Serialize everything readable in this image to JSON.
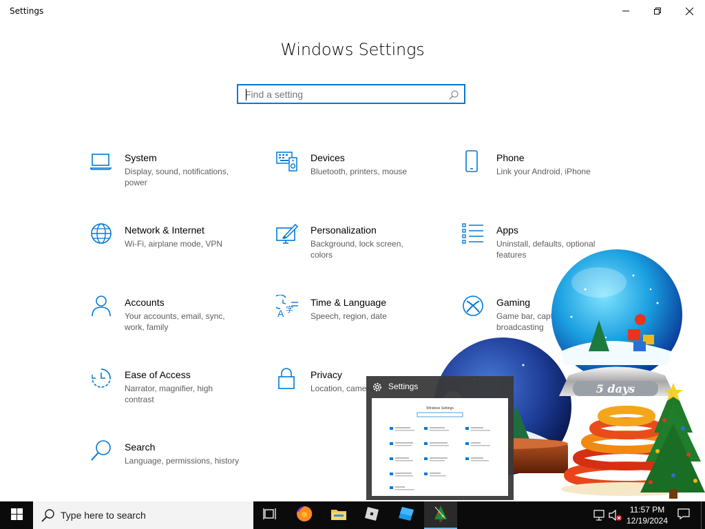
{
  "window": {
    "title": "Settings",
    "heading": "Windows Settings"
  },
  "search": {
    "placeholder": "Find a setting"
  },
  "tiles": [
    {
      "name": "System",
      "desc": "Display, sound, notifications, power",
      "icon": "laptop-icon"
    },
    {
      "name": "Devices",
      "desc": "Bluetooth, printers, mouse",
      "icon": "keyboard-speaker-icon"
    },
    {
      "name": "Phone",
      "desc": "Link your Android, iPhone",
      "icon": "phone-icon"
    },
    {
      "name": "Network & Internet",
      "desc": "Wi-Fi, airplane mode, VPN",
      "icon": "globe-icon"
    },
    {
      "name": "Personalization",
      "desc": "Background, lock screen, colors",
      "icon": "paint-monitor-icon"
    },
    {
      "name": "Apps",
      "desc": "Uninstall, defaults, optional features",
      "icon": "apps-list-icon"
    },
    {
      "name": "Accounts",
      "desc": "Your accounts, email, sync, work, family",
      "icon": "person-icon"
    },
    {
      "name": "Time & Language",
      "desc": "Speech, region, date",
      "icon": "time-language-icon"
    },
    {
      "name": "Gaming",
      "desc": "Game bar, captures, broadcasting",
      "icon": "xbox-icon"
    },
    {
      "name": "Ease of Access",
      "desc": "Narrator, magnifier, high contrast",
      "icon": "ease-of-access-icon"
    },
    {
      "name": "Privacy",
      "desc": "Location, camera",
      "icon": "lock-icon"
    },
    {
      "name": "Search",
      "desc": "Language, permissions, history",
      "icon": "magnifier-icon"
    }
  ],
  "preview": {
    "title": "Settings",
    "mini_heading": "Windows Settings"
  },
  "decoration": {
    "globe_label": "5 days"
  },
  "taskbar": {
    "search_label": "Type here to search",
    "time": "11:57 PM",
    "date": "12/19/2024",
    "apps": [
      "task-view-icon",
      "firefox-icon",
      "file-explorer-icon",
      "roblox-icon",
      "roblox-studio-icon",
      "christmas-tree-app-icon"
    ]
  },
  "colors": {
    "accent": "#0078d7",
    "taskbar": "#0b0b0b"
  }
}
